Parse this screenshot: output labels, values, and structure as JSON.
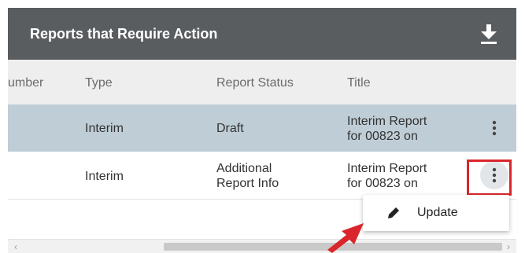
{
  "panel": {
    "title": "Reports that Require Action",
    "download_icon": "download-icon"
  },
  "table": {
    "columns": [
      "umber",
      "Type",
      "Report Status",
      "Title"
    ],
    "rows": [
      {
        "type": "Interim",
        "status": [
          "Draft"
        ],
        "title": [
          "Interim Report",
          "for 00823 on"
        ],
        "selected": true
      },
      {
        "type": "Interim",
        "status": [
          "Additional",
          "Report Info"
        ],
        "title": [
          "Interim Report",
          "for 00823 on"
        ],
        "selected": false
      }
    ]
  },
  "menu": {
    "update_label": "Update",
    "update_icon": "pencil-icon"
  },
  "colors": {
    "header_bg": "#5a5d60",
    "selected_row": "#bfcdd6",
    "highlight": "#d9262c"
  }
}
